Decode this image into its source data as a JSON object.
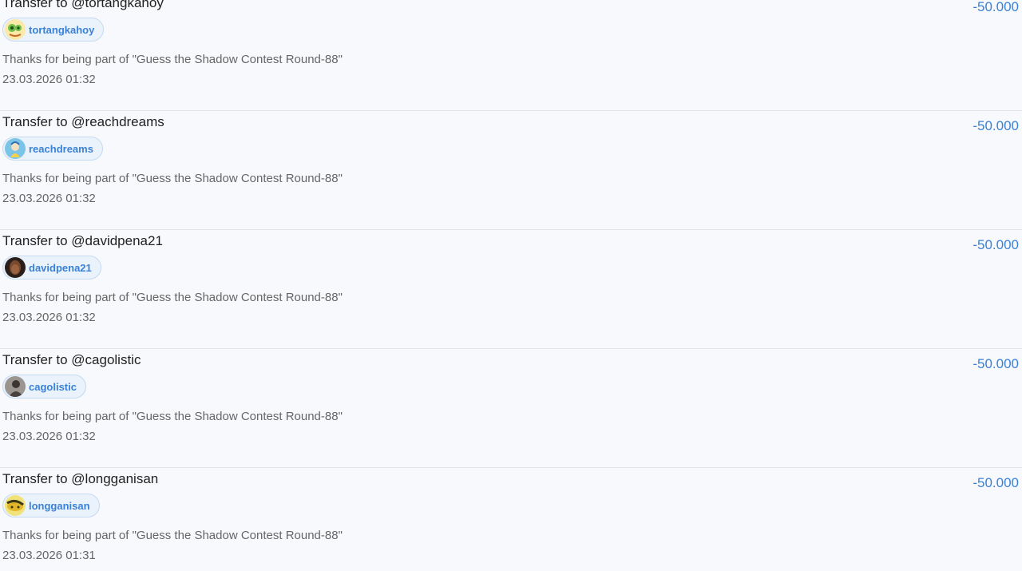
{
  "transactions": [
    {
      "title": "Transfer to @tortangkahoy",
      "user": "tortangkahoy",
      "avatar_icon": "user-avatar-icon",
      "memo": "Thanks for being part of \"Guess the Shadow Contest Round-88\"",
      "datetime": "23.03.2026 01:32",
      "amount": "-50.000"
    },
    {
      "title": "Transfer to @reachdreams",
      "user": "reachdreams",
      "avatar_icon": "user-avatar-icon",
      "memo": "Thanks for being part of \"Guess the Shadow Contest Round-88\"",
      "datetime": "23.03.2026 01:32",
      "amount": "-50.000"
    },
    {
      "title": "Transfer to @davidpena21",
      "user": "davidpena21",
      "avatar_icon": "user-avatar-icon",
      "memo": "Thanks for being part of \"Guess the Shadow Contest Round-88\"",
      "datetime": "23.03.2026 01:32",
      "amount": "-50.000"
    },
    {
      "title": "Transfer to @cagolistic",
      "user": "cagolistic",
      "avatar_icon": "user-avatar-icon",
      "memo": "Thanks for being part of \"Guess the Shadow Contest Round-88\"",
      "datetime": "23.03.2026 01:32",
      "amount": "-50.000"
    },
    {
      "title": "Transfer to @longganisan",
      "user": "longganisan",
      "avatar_icon": "user-avatar-icon",
      "memo": "Thanks for being part of \"Guess the Shadow Contest Round-88\"",
      "datetime": "23.03.2026 01:31",
      "amount": "-50.000"
    }
  ],
  "colors": {
    "amount": "#3a82d6",
    "chip_bg": "#eaf2fc",
    "chip_border": "#c6d9f0",
    "divider": "#e3e5ea"
  }
}
